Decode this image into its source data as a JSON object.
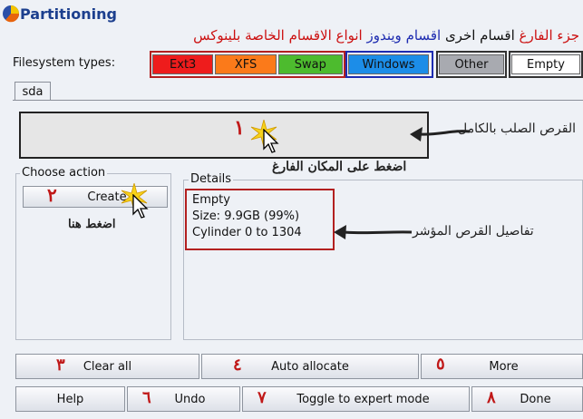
{
  "window": {
    "title": "Partitioning"
  },
  "annotations": {
    "top_red": "جزء الفارغ",
    "top_black": "اقسام اخرى",
    "top_blue": "اقسام ويندوز",
    "top_red2": "انواع الاقسام الخاصة بلينوكس",
    "whole_disk": "القرص الصلب بالكامل",
    "click_empty": "اضغط على المكان الفارغ",
    "click_here": "اضغط هنا",
    "details_desc": "تفاصيل القرص المؤشر"
  },
  "filesystem": {
    "label": "Filesystem types:",
    "types": [
      {
        "label": "Ext3",
        "color": "#ee1c1c"
      },
      {
        "label": "XFS",
        "color": "#fb7a1a"
      },
      {
        "label": "Swap",
        "color": "#4dbb2e"
      },
      {
        "label": "Windows",
        "color": "#1c8de8"
      },
      {
        "label": "Other",
        "color": "#a8aab0"
      },
      {
        "label": "Empty",
        "color": "#ffffff"
      }
    ]
  },
  "tabs": {
    "disk": "sda"
  },
  "markers": {
    "one": "١",
    "two": "٢",
    "three": "٣",
    "four": "٤",
    "five": "٥",
    "six": "٦",
    "seven": "٧",
    "eight": "٨"
  },
  "choose_action": {
    "legend": "Choose action",
    "create_label": "Create"
  },
  "details": {
    "legend": "Details",
    "line1": "Empty",
    "line2": "Size: 9.9GB (99%)",
    "line3": "Cylinder 0 to 1304"
  },
  "buttons": {
    "clear_all": "Clear all",
    "auto_allocate": "Auto allocate",
    "more": "More",
    "help": "Help",
    "undo": "Undo",
    "expert": "Toggle to expert mode",
    "done": "Done"
  }
}
